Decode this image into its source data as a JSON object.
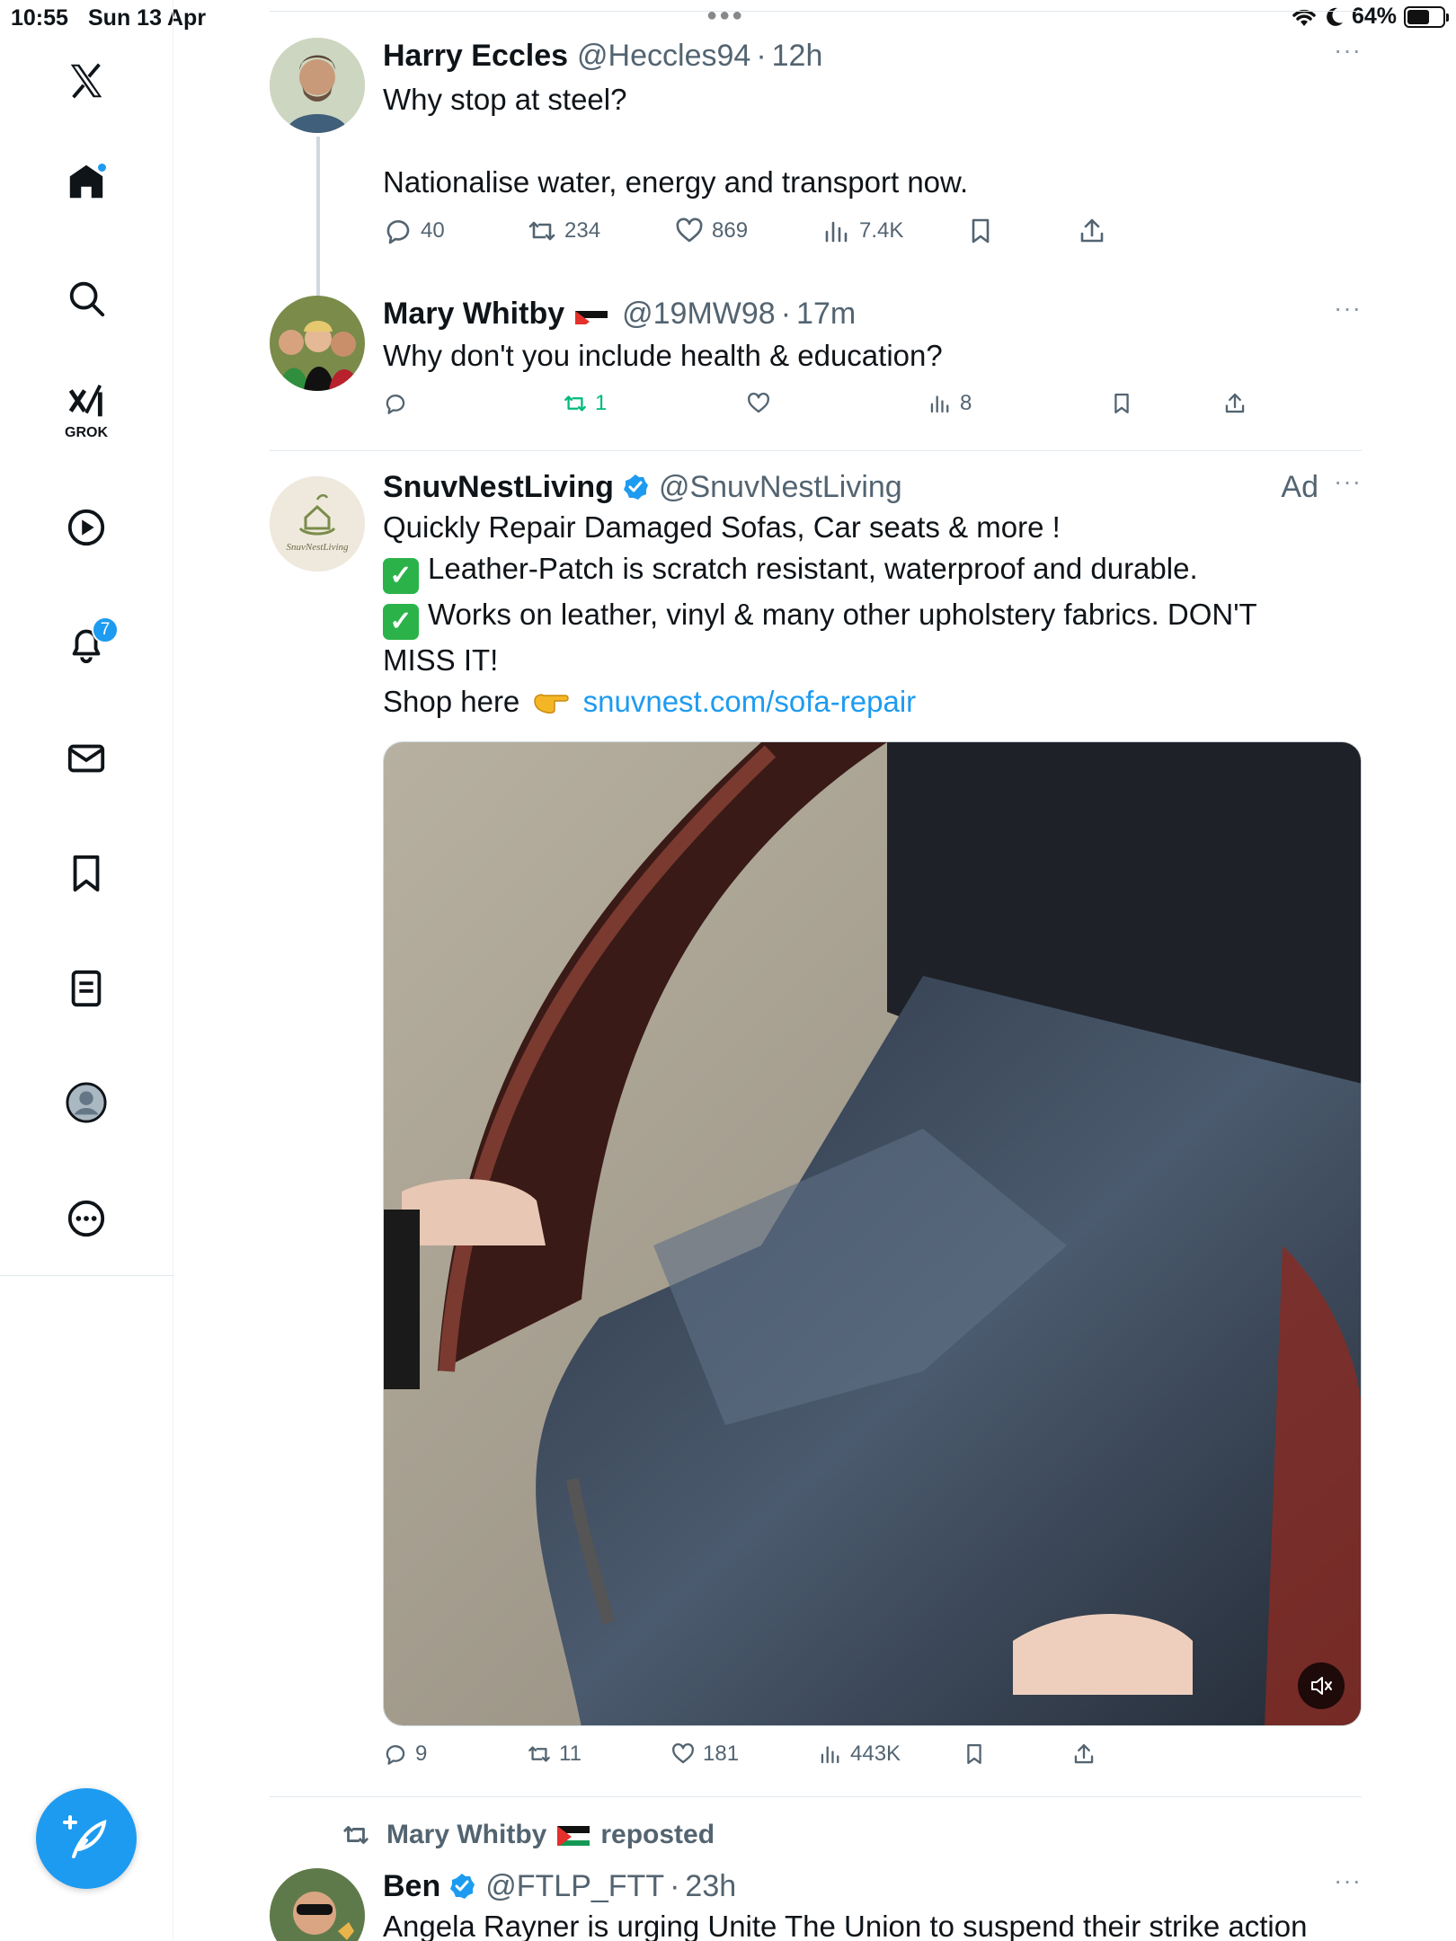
{
  "status": {
    "time": "10:55",
    "date": "Sun 13 Apr",
    "battery": "64%",
    "battery_level": 0.64
  },
  "sidebar": {
    "items": [
      {
        "name": "logo",
        "icon": "x-logo-icon"
      },
      {
        "name": "home",
        "icon": "home-icon",
        "has_dot": true
      },
      {
        "name": "search",
        "icon": "search-icon"
      },
      {
        "name": "grok",
        "icon": "grok-icon",
        "label": "GROK"
      },
      {
        "name": "video",
        "icon": "play-icon"
      },
      {
        "name": "notifications",
        "icon": "bell-icon",
        "badge": "7"
      },
      {
        "name": "messages",
        "icon": "mail-icon"
      },
      {
        "name": "bookmarks",
        "icon": "bookmark-icon"
      },
      {
        "name": "lists",
        "icon": "list-icon"
      },
      {
        "name": "profile",
        "icon": "profile-icon"
      },
      {
        "name": "more",
        "icon": "more-circle-icon"
      }
    ],
    "compose": "compose-icon"
  },
  "tweets": {
    "harry": {
      "name": "Harry Eccles",
      "handle": "@Heccles94",
      "time": "12h",
      "text_line1": "Why stop at steel?",
      "text_line2": "Nationalise water, energy and transport now.",
      "replies": "40",
      "reposts": "234",
      "likes": "869",
      "views": "7.4K"
    },
    "mary": {
      "name": "Mary Whitby",
      "handle": "@19MW98",
      "time": "17m",
      "text": "Why don't you include health & education?",
      "reposts": "1",
      "views": "8"
    },
    "ad": {
      "name": "SnuvNestLiving",
      "handle": "@SnuvNestLiving",
      "ad_label": "Ad",
      "avatar_text": "SnuvNestLiving",
      "line1": "Quickly Repair Damaged Sofas, Car seats & more !",
      "line2": "Leather-Patch is scratch resistant, waterproof and durable.",
      "line3": "Works on leather, vinyl & many other upholstery fabrics. DON'T",
      "line4": "MISS IT!",
      "shop_prefix": "Shop here",
      "link": "snuvnest.com/sofa-repair",
      "replies": "9",
      "reposts": "11",
      "likes": "181",
      "views": "443K"
    },
    "ben": {
      "repost_by": "Mary Whitby",
      "repost_suffix": "reposted",
      "name": "Ben",
      "handle": "@FTLP_FTT",
      "time": "23h",
      "text": "Angela Rayner is urging Unite The Union to suspend their strike action"
    }
  },
  "separator": "·",
  "more_glyph": "···"
}
